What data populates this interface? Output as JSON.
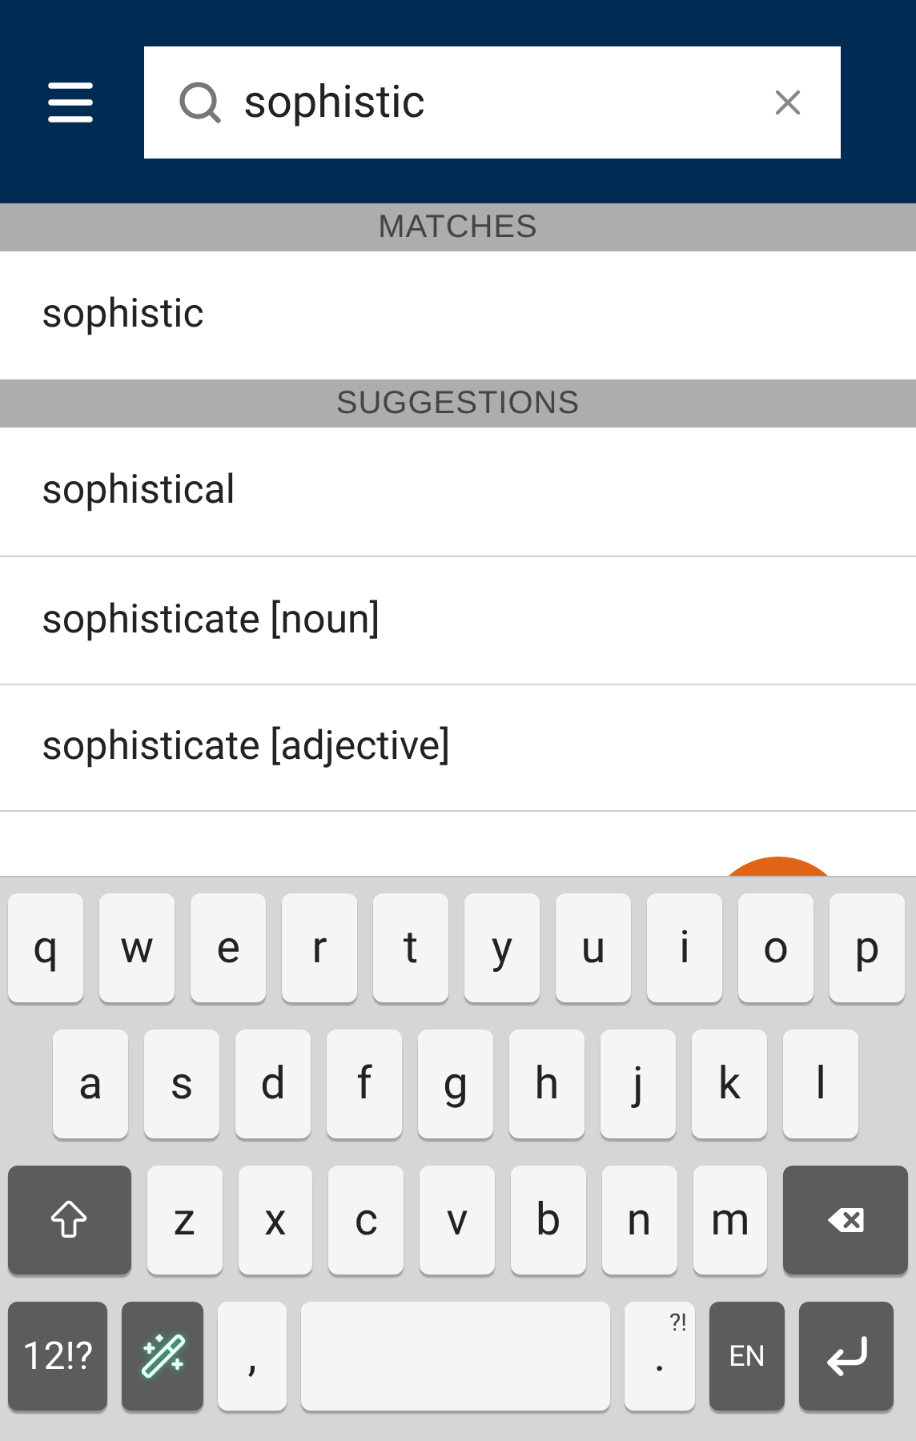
{
  "search": {
    "value": "sophistic"
  },
  "sections": [
    {
      "title": "MATCHES",
      "items": [
        "sophistic"
      ]
    },
    {
      "title": "SUGGESTIONS",
      "items": [
        "sophistical",
        "sophisticate [noun]",
        "sophisticate [adjective]"
      ]
    }
  ],
  "keyboard": {
    "rows": [
      [
        {
          "kind": "letter",
          "label": "q"
        },
        {
          "kind": "letter",
          "label": "w"
        },
        {
          "kind": "letter",
          "label": "e"
        },
        {
          "kind": "letter",
          "label": "r"
        },
        {
          "kind": "letter",
          "label": "t"
        },
        {
          "kind": "letter",
          "label": "y"
        },
        {
          "kind": "letter",
          "label": "u"
        },
        {
          "kind": "letter",
          "label": "i"
        },
        {
          "kind": "letter",
          "label": "o"
        },
        {
          "kind": "letter",
          "label": "p"
        }
      ],
      [
        {
          "kind": "letter",
          "label": "a"
        },
        {
          "kind": "letter",
          "label": "s"
        },
        {
          "kind": "letter",
          "label": "d"
        },
        {
          "kind": "letter",
          "label": "f"
        },
        {
          "kind": "letter",
          "label": "g"
        },
        {
          "kind": "letter",
          "label": "h"
        },
        {
          "kind": "letter",
          "label": "j"
        },
        {
          "kind": "letter",
          "label": "k"
        },
        {
          "kind": "letter",
          "label": "l"
        }
      ],
      [
        {
          "kind": "shift"
        },
        {
          "kind": "letter",
          "label": "z"
        },
        {
          "kind": "letter",
          "label": "x"
        },
        {
          "kind": "letter",
          "label": "c"
        },
        {
          "kind": "letter",
          "label": "v"
        },
        {
          "kind": "letter",
          "label": "b"
        },
        {
          "kind": "letter",
          "label": "n"
        },
        {
          "kind": "letter",
          "label": "m"
        },
        {
          "kind": "backspace"
        }
      ],
      [
        {
          "kind": "symbols",
          "label": "12!?"
        },
        {
          "kind": "magic"
        },
        {
          "kind": "punct",
          "label": ","
        },
        {
          "kind": "space"
        },
        {
          "kind": "punct",
          "label": ".",
          "hint": "?!"
        },
        {
          "kind": "lang",
          "label": "EN"
        },
        {
          "kind": "enter"
        }
      ]
    ]
  }
}
